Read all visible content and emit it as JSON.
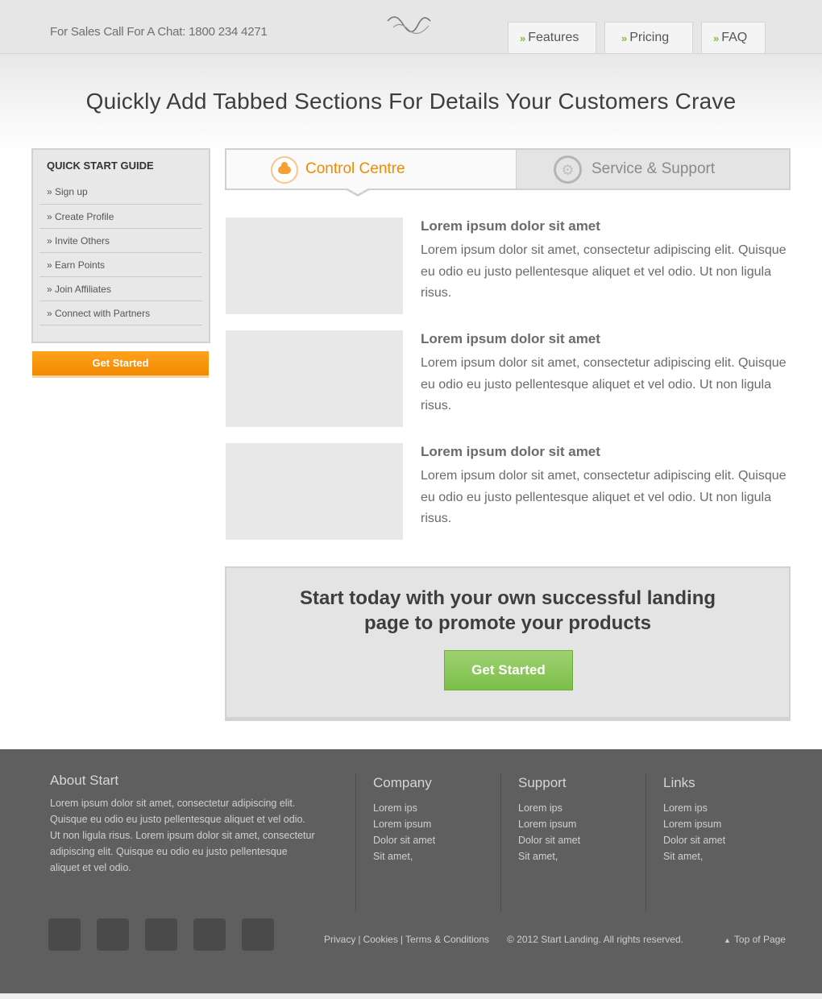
{
  "header": {
    "sales_line": "For Sales Call For A Chat: 1800 234 4271",
    "nav": [
      {
        "label": "Features"
      },
      {
        "label": "Pricing"
      },
      {
        "label": "FAQ"
      }
    ]
  },
  "hero": {
    "headline": "Quickly Add Tabbed Sections For Details Your Customers Crave"
  },
  "sidebar": {
    "title": "QUICK START GUIDE",
    "items": [
      {
        "label": "» Sign up"
      },
      {
        "label": "» Create Profile"
      },
      {
        "label": "» Invite Others"
      },
      {
        "label": "» Earn Points"
      },
      {
        "label": "» Join Affiliates"
      },
      {
        "label": "» Connect with Partners"
      }
    ],
    "cta_label": "Get Started"
  },
  "tabs": [
    {
      "label": "Control Centre",
      "icon": "cloud-icon",
      "active": true
    },
    {
      "label": "Service & Support",
      "icon": "gear-icon",
      "active": false
    }
  ],
  "features": [
    {
      "title": "Lorem ipsum dolor sit amet",
      "text": "Lorem ipsum dolor sit amet, consectetur adipiscing elit. Quisque eu odio eu justo pellentesque aliquet et vel odio. Ut non ligula risus."
    },
    {
      "title": "Lorem ipsum dolor sit amet",
      "text": "Lorem ipsum dolor sit amet, consectetur adipiscing elit. Quisque eu odio eu justo pellentesque aliquet et vel odio. Ut non ligula risus."
    },
    {
      "title": "Lorem ipsum dolor sit amet",
      "text": "Lorem ipsum dolor sit amet, consectetur adipiscing elit. Quisque eu odio eu justo pellentesque aliquet et vel odio. Ut non ligula risus."
    }
  ],
  "cta": {
    "line1": "Start today with your own successful landing",
    "line2": "page to promote your products",
    "button_label": "Get Started"
  },
  "footer": {
    "about_title": "About Start",
    "about_text": "Lorem ipsum dolor sit amet, consectetur adipiscing elit. Quisque eu odio eu justo pellentesque aliquet et vel odio. Ut non ligula risus.  Lorem ipsum dolor sit amet, consectetur adipiscing elit. Quisque eu odio eu justo pellentesque aliquet et vel odio.",
    "columns": [
      {
        "title": "Company",
        "items": [
          "Lorem ips",
          "Lorem ipsum",
          "Dolor sit amet",
          "Sit amet,"
        ]
      },
      {
        "title": "Support",
        "items": [
          "Lorem ips",
          "Lorem ipsum",
          "Dolor sit amet",
          "Sit amet,"
        ]
      },
      {
        "title": "Links",
        "items": [
          "Lorem ips",
          "Lorem ipsum",
          "Dolor sit amet",
          "Sit amet,"
        ]
      }
    ],
    "links": [
      "Privacy",
      "Cookies",
      "Terms & Conditions"
    ],
    "copyright": "© 2012 Start Landing. All rights reserved.",
    "top_of_page": "Top of Page"
  },
  "colors": {
    "accent_orange": "#f28a00",
    "accent_green": "#7cbf4a",
    "footer_bg": "#5f5f5f"
  }
}
